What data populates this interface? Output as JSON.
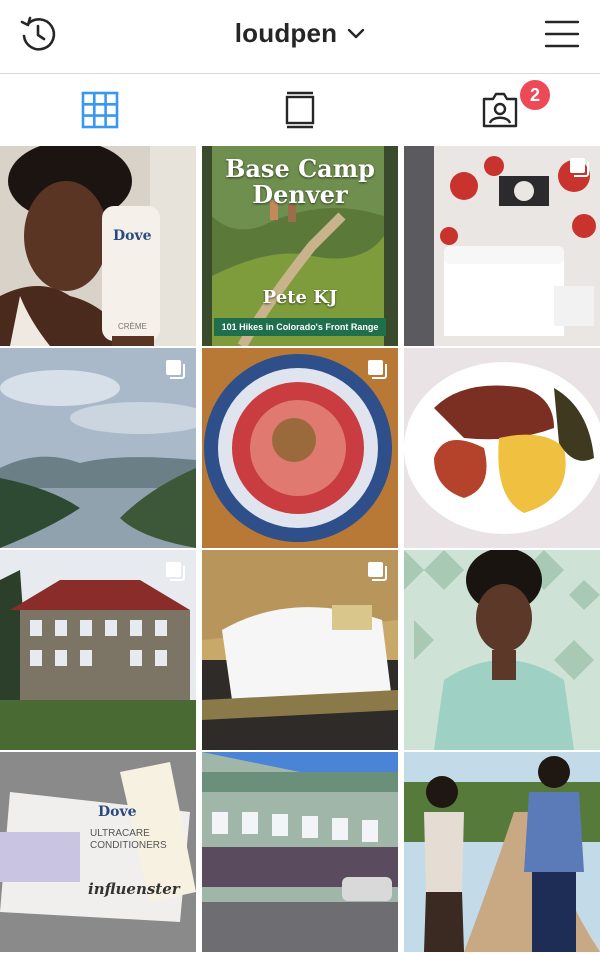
{
  "header": {
    "username": "loudpen",
    "history_icon": "history-icon",
    "dropdown_icon": "chevron-down-icon",
    "menu_icon": "hamburger-menu-icon"
  },
  "tabs": [
    {
      "name": "grid",
      "icon": "grid-icon",
      "active": true
    },
    {
      "name": "feed",
      "icon": "feed-icon",
      "active": false
    },
    {
      "name": "tagged",
      "icon": "tagged-photos-icon",
      "active": false,
      "badge": "2"
    }
  ],
  "colors": {
    "accent": "#3897f0",
    "icon": "#262626",
    "badge": "#ed4956",
    "divider": "#dbdbdb"
  },
  "posts": [
    {
      "subject": "woman holding Dove creme bottle",
      "multi": false,
      "text": {
        "bottle": "Dove",
        "small": "CRÈME"
      }
    },
    {
      "subject": "book cover",
      "multi": false,
      "text": {
        "title": "Base Camp Denver",
        "author": "Pete KJ",
        "subtitle": "101 Hikes in Colorado's Front Range"
      }
    },
    {
      "subject": "hotel room with red mural",
      "multi": true
    },
    {
      "subject": "river gorge landscape",
      "multi": true
    },
    {
      "subject": "plate on wooden table",
      "multi": true
    },
    {
      "subject": "plate of soul food",
      "multi": false
    },
    {
      "subject": "historic mansion",
      "multi": true
    },
    {
      "subject": "hotel bed",
      "multi": true
    },
    {
      "subject": "laughing woman portrait",
      "multi": false
    },
    {
      "subject": "Dove Ultracare conditioners box",
      "multi": false,
      "text": {
        "brand": "Dove",
        "product": "ULTRACARE CONDITIONERS",
        "sticker": "influenster"
      }
    },
    {
      "subject": "street with storefronts",
      "multi": false
    },
    {
      "subject": "couple on dirt road",
      "multi": false
    }
  ]
}
